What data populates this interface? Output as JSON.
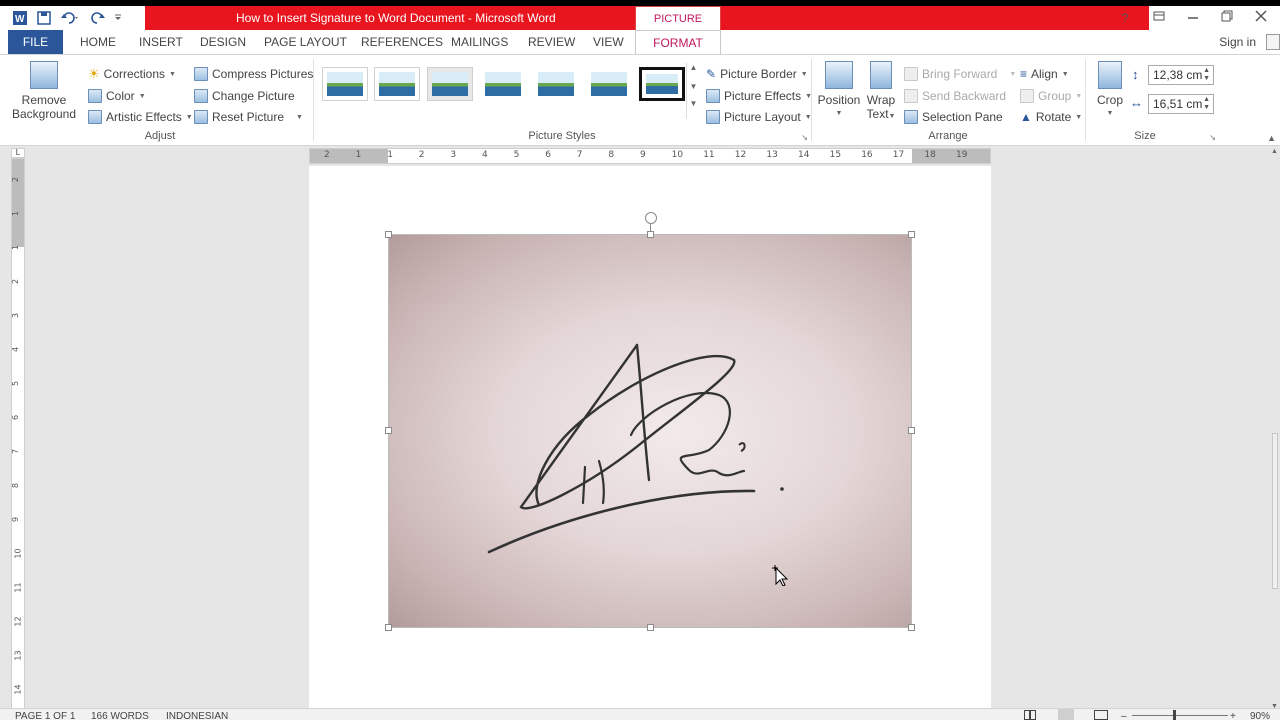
{
  "window": {
    "title": "How to Insert Signature to Word Document - Microsoft Word",
    "context_tab": "PICTURE TOOLS",
    "help": "?"
  },
  "tabs": {
    "file": "FILE",
    "home": "HOME",
    "insert": "INSERT",
    "design": "DESIGN",
    "page_layout": "PAGE LAYOUT",
    "references": "REFERENCES",
    "mailings": "MAILINGS",
    "review": "REVIEW",
    "view": "VIEW",
    "format": "FORMAT",
    "sign_in": "Sign in"
  },
  "ribbon": {
    "adjust": {
      "remove_background_line1": "Remove",
      "remove_background_line2": "Background",
      "corrections": "Corrections",
      "color": "Color",
      "artistic_effects": "Artistic Effects",
      "compress_pictures": "Compress Pictures",
      "change_picture": "Change Picture",
      "reset_picture": "Reset Picture",
      "label": "Adjust"
    },
    "picture_styles": {
      "picture_border": "Picture Border",
      "picture_effects": "Picture Effects",
      "picture_layout": "Picture Layout",
      "label": "Picture Styles"
    },
    "arrange": {
      "position": "Position",
      "wrap_text_line1": "Wrap",
      "wrap_text_line2": "Text",
      "bring_forward": "Bring Forward",
      "send_backward": "Send Backward",
      "selection_pane": "Selection Pane",
      "align": "Align",
      "group": "Group",
      "rotate": "Rotate",
      "label": "Arrange"
    },
    "size": {
      "crop": "Crop",
      "height": "12,38 cm",
      "width": "16,51 cm",
      "label": "Size"
    }
  },
  "ruler": {
    "top_numbers": [
      "2",
      "1",
      "1",
      "2",
      "3",
      "4",
      "5",
      "6",
      "7",
      "8",
      "9",
      "10",
      "11",
      "12",
      "13",
      "14",
      "15",
      "16",
      "17",
      "18",
      "19"
    ],
    "left_numbers": [
      "2",
      "1",
      "1",
      "2",
      "3",
      "4",
      "5",
      "6",
      "7",
      "8",
      "9",
      "10",
      "11",
      "12",
      "13",
      "14"
    ]
  },
  "status": {
    "page": "PAGE 1 OF 1",
    "words": "166 WORDS",
    "language": "INDONESIAN",
    "zoom": "90%"
  },
  "colors": {
    "title_band": "#e8141e",
    "file_tab": "#2b579a",
    "context_accent": "#c0165d"
  }
}
